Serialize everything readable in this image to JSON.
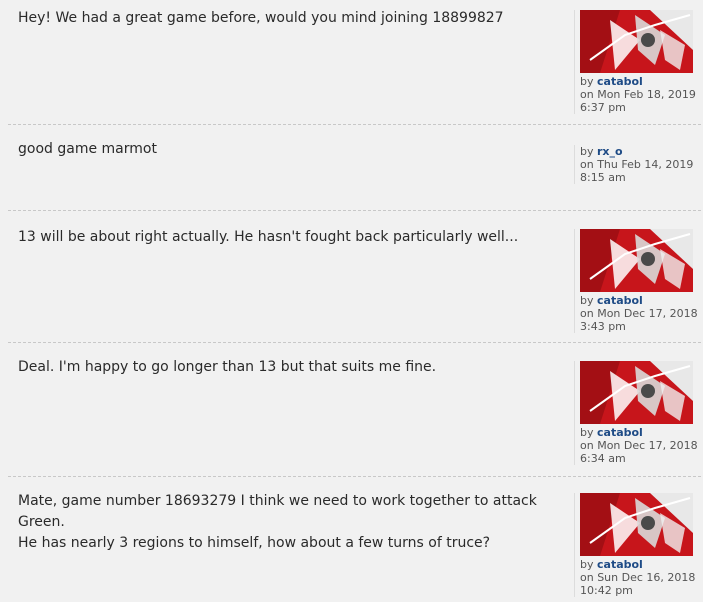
{
  "by_label": "by",
  "posts": [
    {
      "text": "Hey! We had a great game before, would you mind joining 18899827",
      "author": "catabol",
      "date_line": "on Mon Feb 18, 2019",
      "time_line": "6:37 pm",
      "has_avatar": true
    },
    {
      "text": "good game marmot",
      "author": "rx_o",
      "date_line": "on Thu Feb 14, 2019",
      "time_line": "8:15 am",
      "has_avatar": false
    },
    {
      "text": "13 will be about right actually. He hasn't fought back particularly well...",
      "author": "catabol",
      "date_line": "on Mon Dec 17, 2018",
      "time_line": "3:43 pm",
      "has_avatar": true
    },
    {
      "text": "Deal. I'm happy to go longer than 13 but that suits me fine.",
      "author": "catabol",
      "date_line": "on Mon Dec 17, 2018",
      "time_line": "6:34 am",
      "has_avatar": true
    },
    {
      "text": "Mate, game number 18693279 I think we need to work together to attack Green.\nHe has nearly 3 regions to himself, how about a few turns of truce?",
      "author": "catabol",
      "date_line": "on Sun Dec 16, 2018",
      "time_line": "10:42 pm",
      "has_avatar": true
    }
  ]
}
